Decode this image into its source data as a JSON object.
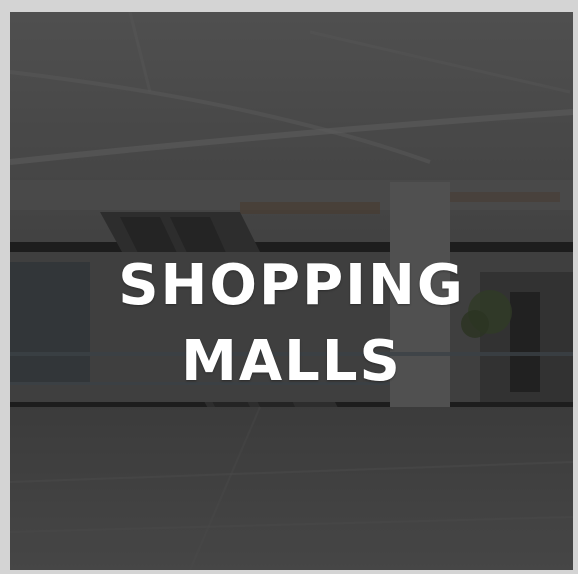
{
  "tile": {
    "line1": "SHOPPING",
    "line2": "MALLS"
  }
}
